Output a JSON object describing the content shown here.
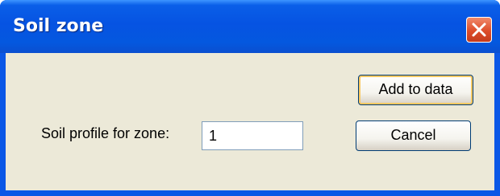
{
  "dialog": {
    "title": "Soil zone",
    "close_icon": "close-icon",
    "label": "Soil profile for zone:",
    "zone_value": "1",
    "add_button": "Add to data",
    "cancel_button": "Cancel"
  },
  "colors": {
    "titlebar": "#0653e2",
    "client_bg": "#ece9d8",
    "close_button": "#dd4d2a"
  }
}
